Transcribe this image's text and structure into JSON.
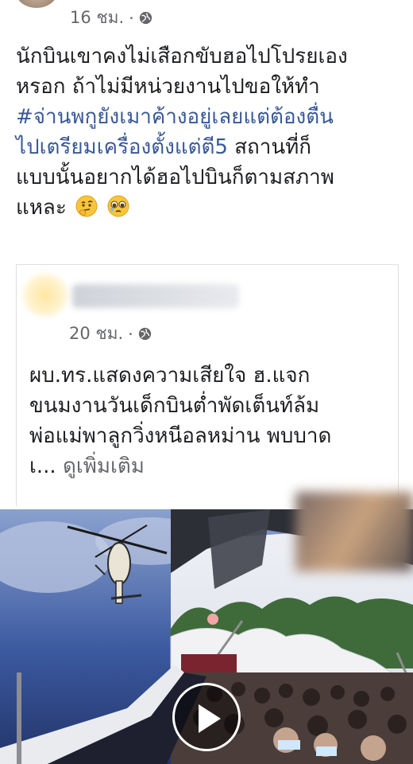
{
  "post": {
    "time": "16 ชม.",
    "separator": "·",
    "privacy_icon": "globe-icon",
    "text_line_1": "นักบินเขาคงไม่เสือกขับฮอไปโปรยเอง",
    "text_line_2": "หรอก ถ้าไม่มีหน่วยงานไปขอให้ทำ",
    "hashtag_line_1": "#จ่านพกูยังเมาค้างอยู่เลยแต่ต้องตื่น",
    "hashtag_line_2": "ไปเตรียมเครื่องตั้งแต่ตี5",
    "text_line_5_rest": " สถานที่ก็",
    "text_line_6": "แบบนั้นอยากได้ฮอไปบินก็ตามสภาพ",
    "text_line_7": "แหละ",
    "emojis": [
      "thinking-face-icon",
      "pleading-face-icon"
    ]
  },
  "shared_post": {
    "time": "20 ชม.",
    "separator": "·",
    "privacy_icon": "globe-icon",
    "text_line_1": "ผบ.ทร.แสดงความเสียใจ ฮ.แจก",
    "text_line_2": "ขนมงานวันเด็กบินต่ำพัดเต็นท์ล้ม",
    "text_line_3": "พ่อแม่พาลูกวิ่งหนีอลหม่าน พบบาด",
    "text_line_4": "เ...",
    "see_more": "ดูเพิ่มเติม"
  },
  "video": {
    "play_icon": "play-icon",
    "sky_color": "#3c5aa0",
    "tent_color": "#f2f2f4"
  }
}
